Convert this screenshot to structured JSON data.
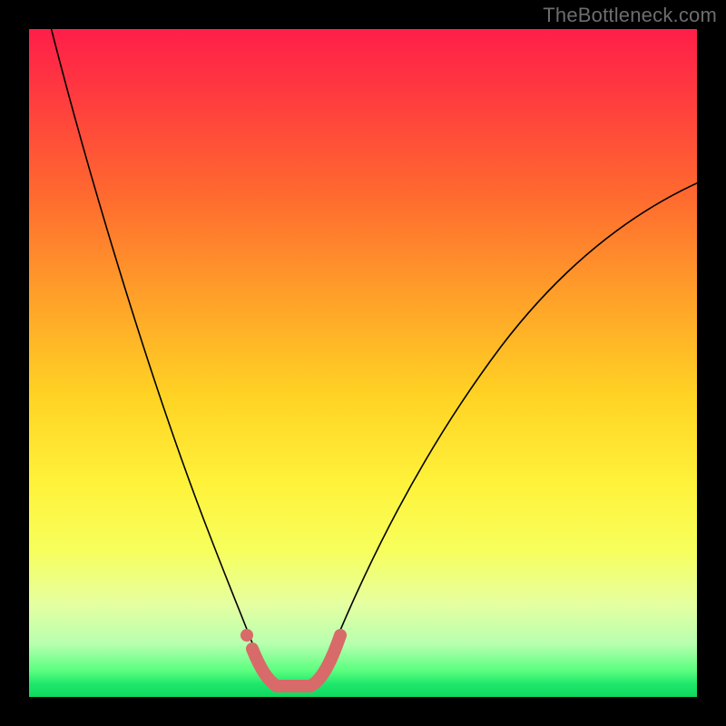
{
  "watermark": "TheBottleneck.com",
  "chart_data": {
    "type": "line",
    "title": "",
    "xlabel": "",
    "ylabel": "",
    "xlim": [
      0,
      1
    ],
    "ylim": [
      0,
      1
    ],
    "gradient": {
      "top_color": "#ff1e49",
      "bottom_color": "#0fd85f",
      "mid_color": "#fff23a"
    },
    "series": [
      {
        "name": "bottleneck-curve",
        "color": "#000000",
        "x": [
          0.03,
          0.07,
          0.11,
          0.15,
          0.19,
          0.23,
          0.27,
          0.3,
          0.33,
          0.36,
          0.4,
          0.45,
          0.52,
          0.6,
          0.7,
          0.8,
          0.9,
          1.0
        ],
        "y": [
          1.0,
          0.84,
          0.7,
          0.57,
          0.45,
          0.33,
          0.22,
          0.12,
          0.05,
          0.02,
          0.02,
          0.06,
          0.18,
          0.34,
          0.5,
          0.62,
          0.71,
          0.77
        ]
      },
      {
        "name": "highlight-flat-region",
        "color": "#d86a6a",
        "x": [
          0.3,
          0.33,
          0.36,
          0.4,
          0.43
        ],
        "y": [
          0.08,
          0.03,
          0.02,
          0.02,
          0.05
        ]
      }
    ],
    "points": [
      {
        "name": "highlight-dot",
        "x": 0.295,
        "y": 0.085,
        "color": "#d86a6a"
      }
    ]
  }
}
